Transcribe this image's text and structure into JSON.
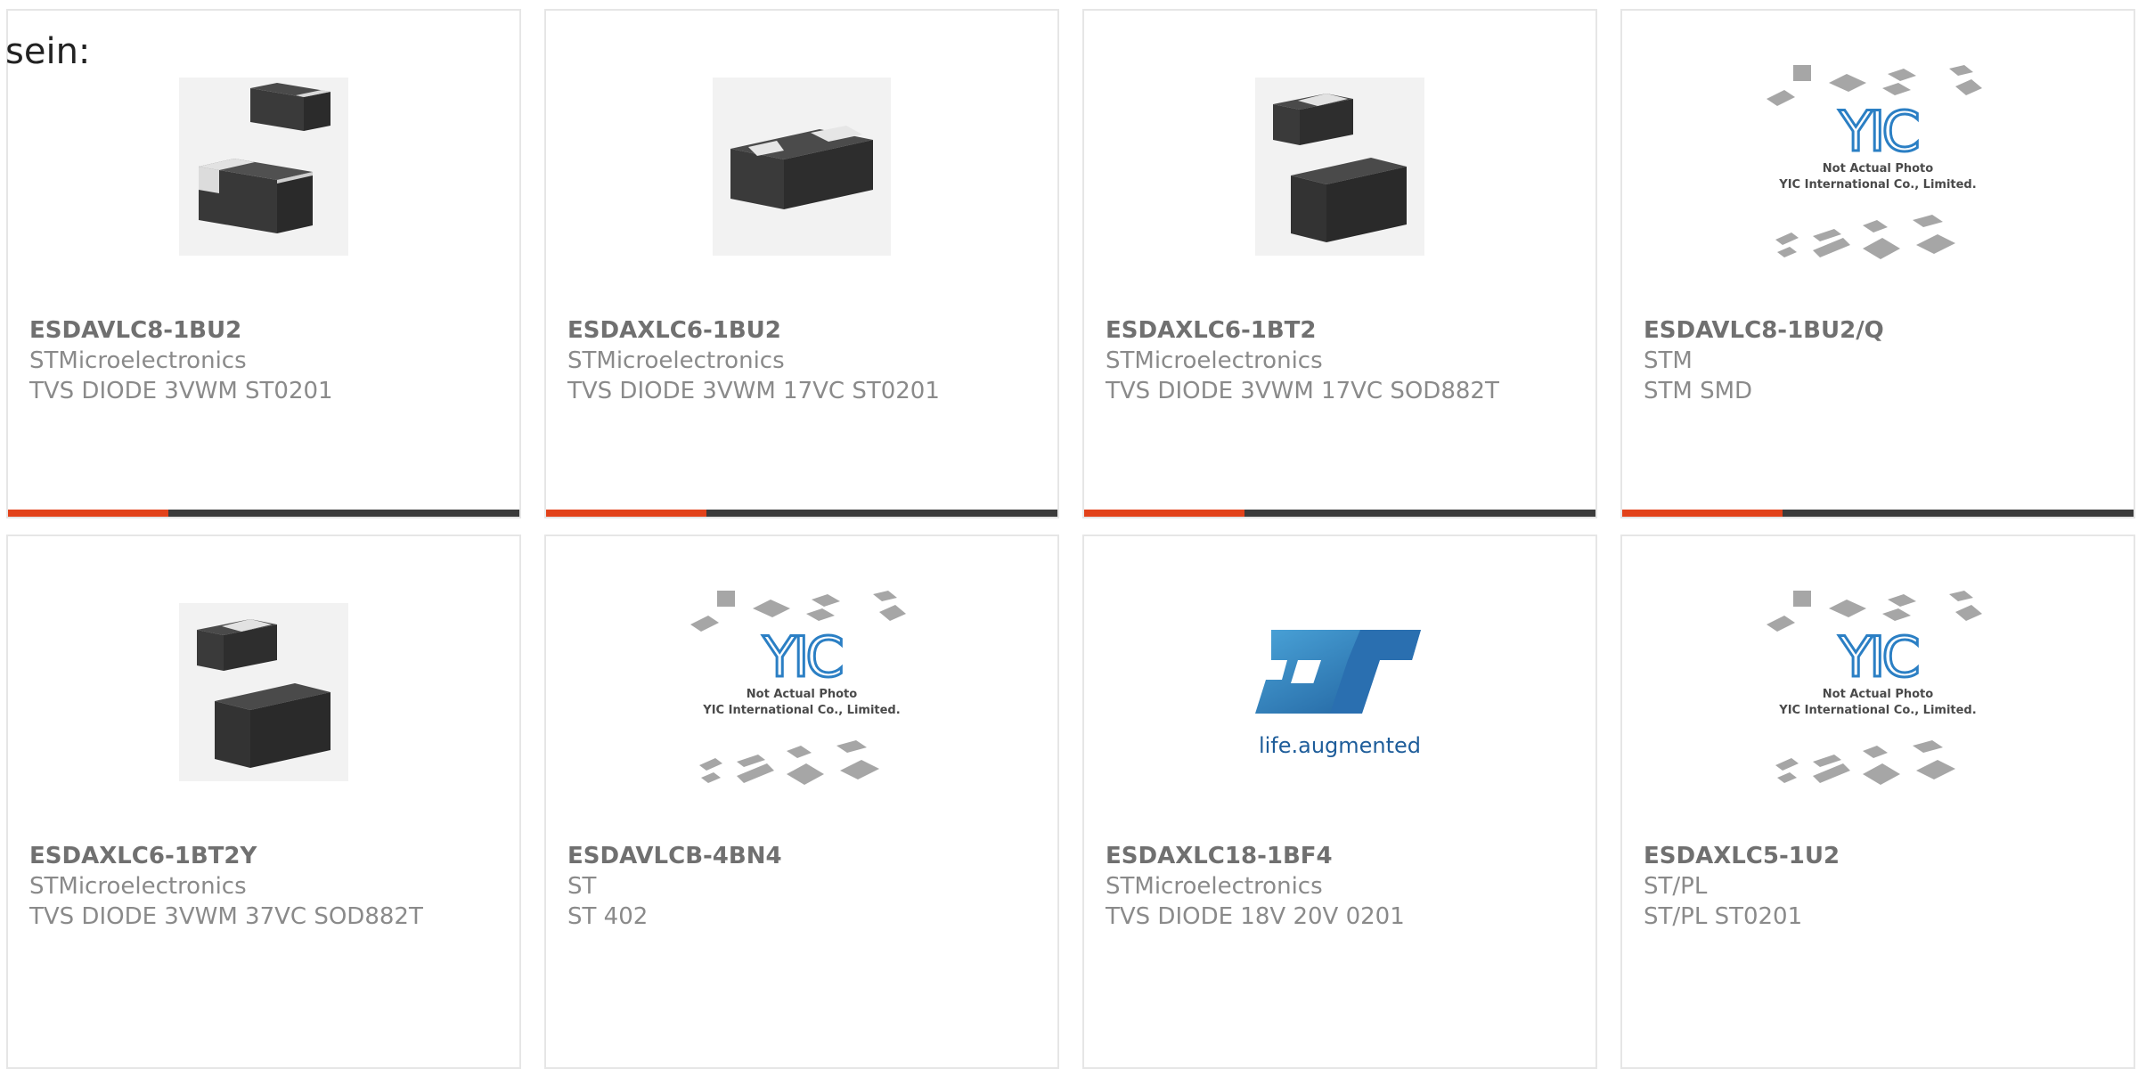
{
  "page": {
    "heading": "sein:"
  },
  "colors": {
    "accent": "#e2421a",
    "bar": "#3b3b3b",
    "border": "#e6e6e6"
  },
  "products": [
    {
      "part_number": "ESDAVLC8-1BU2",
      "manufacturer": "STMicroelectronics",
      "description": "TVS DIODE 3VWM ST0201",
      "image": "two-chip-diode-photo"
    },
    {
      "part_number": "ESDAXLC6-1BU2",
      "manufacturer": "STMicroelectronics",
      "description": "TVS DIODE 3VWM 17VC ST0201",
      "image": "single-chip-diode-photo"
    },
    {
      "part_number": "ESDAXLC6-1BT2",
      "manufacturer": "STMicroelectronics",
      "description": "TVS DIODE 3VWM 17VC SOD882T",
      "image": "two-chip-diode-photo"
    },
    {
      "part_number": "ESDAVLC8-1BU2/Q",
      "manufacturer": "STM",
      "description": "STM SMD",
      "image": "yic-placeholder",
      "placeholder_line1": "Not Actual Photo",
      "placeholder_line2": "YIC International Co., Limited."
    },
    {
      "part_number": "ESDAXLC6-1BT2Y",
      "manufacturer": "STMicroelectronics",
      "description": "TVS DIODE 3VWM 37VC SOD882T",
      "image": "two-chip-diode-photo"
    },
    {
      "part_number": "ESDAVLCB-4BN4",
      "manufacturer": "ST",
      "description": "ST 402",
      "image": "yic-placeholder",
      "placeholder_line1": "Not Actual Photo",
      "placeholder_line2": "YIC International Co., Limited."
    },
    {
      "part_number": "ESDAXLC18-1BF4",
      "manufacturer": "STMicroelectronics",
      "description": "TVS DIODE 18V 20V 0201",
      "image": "st-logo",
      "logo_text": "life.augmented"
    },
    {
      "part_number": "ESDAXLC5-1U2",
      "manufacturer": "ST/PL",
      "description": "ST/PL ST0201",
      "image": "yic-placeholder",
      "placeholder_line1": "Not Actual Photo",
      "placeholder_line2": "YIC International Co., Limited."
    }
  ]
}
